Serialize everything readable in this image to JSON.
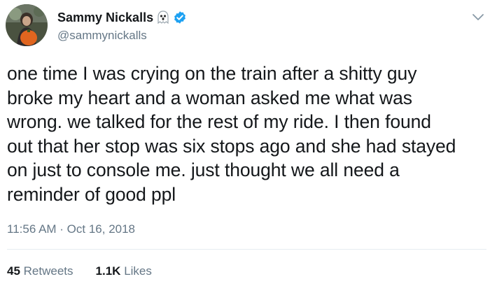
{
  "user": {
    "display_name": "Sammy Nickalls",
    "handle": "@sammynickalls",
    "avatar_icon": "profile-photo-avatar",
    "name_emoji_icon": "ghost-icon",
    "verified_icon": "verified-badge-icon",
    "verified_color": "#1da1f2"
  },
  "tweet": {
    "lines": [
      "one time I was crying on the train after a shitty guy",
      "broke my heart and a woman asked me what was",
      "wrong. we talked for the rest of my ride. I then found",
      "out that her stop was six stops ago and she had stayed",
      "on just to console me. just thought we all need a",
      "reminder of good ppl"
    ],
    "timestamp": "11:56 AM · Oct 16, 2018"
  },
  "stats": {
    "retweets_count": "45",
    "retweets_label": "Retweets",
    "likes_count": "1.1K",
    "likes_label": "Likes"
  },
  "menu": {
    "chevron_icon": "chevron-down-icon"
  },
  "colors": {
    "text": "#14171a",
    "secondary": "#657786",
    "divider": "#e6ecf0"
  }
}
